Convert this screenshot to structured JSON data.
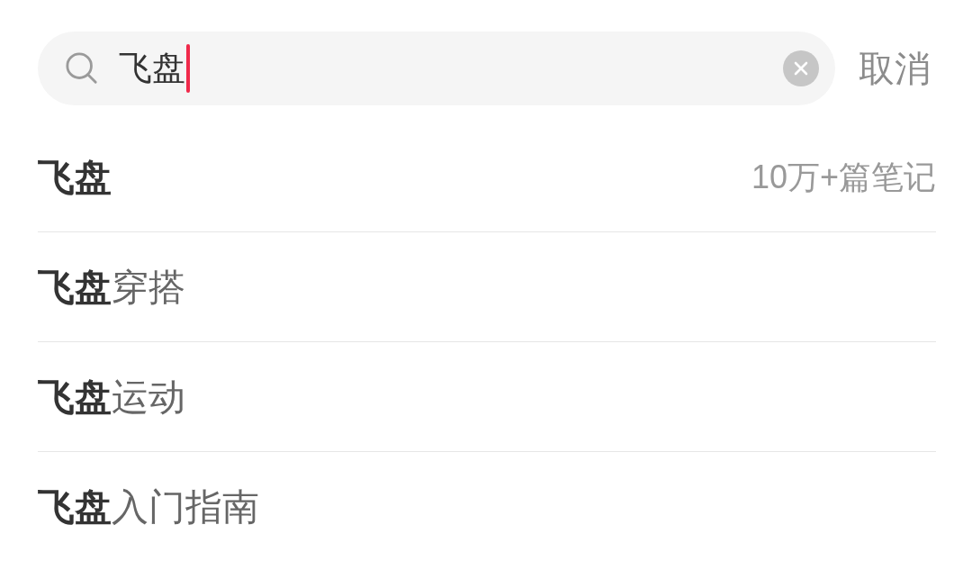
{
  "search": {
    "value": "飞盘",
    "focused": true
  },
  "cancel_button": "取消",
  "suggestions": [
    {
      "match": "飞盘",
      "note": "10万+篇笔记"
    },
    {
      "match": "飞盘",
      "completion": "穿搭"
    },
    {
      "match": "飞盘",
      "completion": "运动"
    },
    {
      "match": "飞盘",
      "completion": "入门指南"
    }
  ]
}
